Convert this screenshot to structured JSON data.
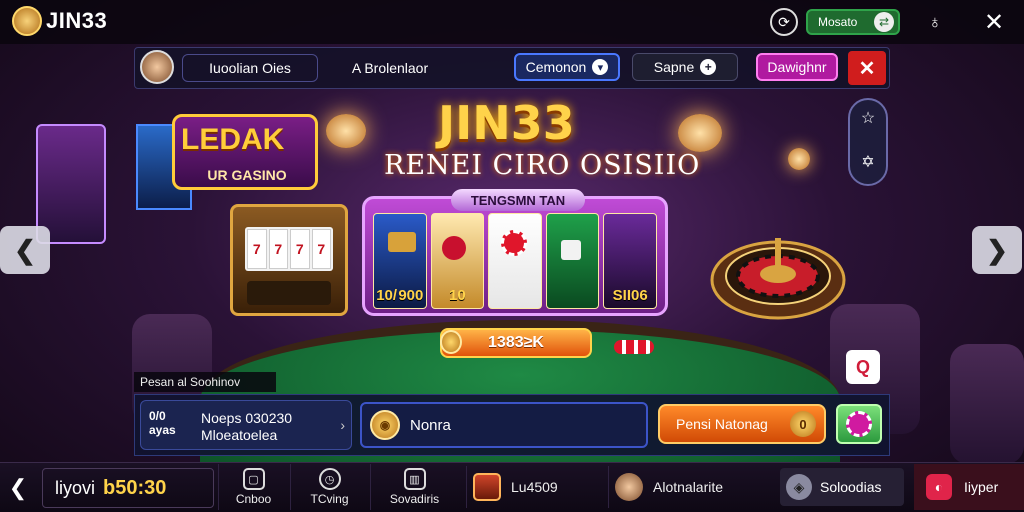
{
  "brand": {
    "name": "JIN33"
  },
  "top": {
    "mode_label": "Mosato",
    "mode_knob": "⇄"
  },
  "subnav": {
    "tab1": "Iuoolian Oies",
    "tab2": "A Brolenlaor",
    "campaign": "Cemonon",
    "campaign_icon": "▾",
    "game": "Sapne",
    "game_icon": "+",
    "daughter": "Dawighnr"
  },
  "hero": {
    "badge_line1": "LEDAK",
    "badge_line2": "UR GASINO",
    "title": "JIN33",
    "subtitle": "RENEI CIRO OSISIIO",
    "promo_header": "TENGSMN TAN",
    "card_values": [
      "10/ 900",
      "10",
      "",
      "",
      "SII06"
    ],
    "jackpot": "1383≥K",
    "slot_reels": [
      "7",
      "7",
      "7",
      "7"
    ]
  },
  "caption": "Pesan al Soohinov",
  "info": {
    "logo": "0/0\nayas",
    "line1": "Noeps 030230",
    "line2": "Mloeatoelea",
    "arrow": "›",
    "input_value": "Nonra",
    "cta": "Pensi Natonag",
    "cta_knob": "0"
  },
  "bottom": {
    "balance_label": "liyovi",
    "balance_amount": "b50:30",
    "nav": [
      {
        "label": "Cnboo",
        "icon": "▢"
      },
      {
        "label": "TCving",
        "icon": "◷"
      },
      {
        "label": "Sovadiris",
        "icon": "▥"
      }
    ],
    "lu_label": "Lu4509",
    "alm_label": "Alotnalarite",
    "soc_label": "Soloodias",
    "hyper_label": "Iiyper",
    "hyper_icon": "◐"
  },
  "colors": {
    "accent_gold": "#ffd34a",
    "accent_orange": "#e0520b",
    "felt_green": "#1f8a45",
    "hyper_red": "#e0244a"
  }
}
